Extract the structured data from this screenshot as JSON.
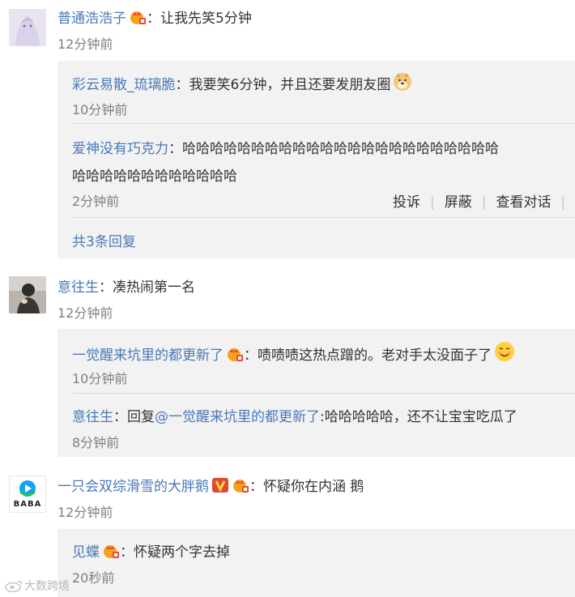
{
  "comments": [
    {
      "user": "普通浩浩子",
      "text": "：让我先笑5分钟",
      "time": "12分钟前",
      "replies": [
        {
          "user": "彩云易散_琉璃脆",
          "text": "：我要笑6分钟，并且还要发朋友圈",
          "time": "10分钟前"
        },
        {
          "user": "爱神没有巧克力",
          "text_line1": "：哈哈哈哈哈哈哈哈哈哈哈哈哈哈哈哈哈哈哈哈哈哈哈",
          "text_line2": "哈哈哈哈哈哈哈哈哈哈哈哈",
          "time": "2分钟前"
        }
      ],
      "actions": [
        "投诉",
        "屏蔽",
        "查看对话"
      ],
      "more": "共3条回复"
    },
    {
      "user": "意往生",
      "text": "：凑热闹第一名",
      "time": "12分钟前",
      "replies": [
        {
          "user": "一觉醒来坑里的都更新了",
          "text": "：啧啧啧这热点蹭的。老对手太没面子了",
          "time": "10分钟前"
        },
        {
          "user": "意往生",
          "text_prefix": "：回复",
          "mention": "@一觉醒来坑里的都更新了",
          "text": ":哈哈哈哈哈，还不让宝宝吃瓜了",
          "time": "8分钟前"
        }
      ]
    },
    {
      "user": "一只会双综滑雪的大胖鹅",
      "text": "：怀疑你在内涵 鹅",
      "time": "12分钟前",
      "avatar_text": "BABA",
      "replies": [
        {
          "user": "见蝶",
          "text": "：怀疑两个字去掉",
          "time": "20秒前"
        }
      ]
    }
  ],
  "watermark": "大数跨境",
  "colors": {
    "name": "#4a78b8",
    "reply_bg": "#f2f2f2",
    "time": "#808080"
  }
}
